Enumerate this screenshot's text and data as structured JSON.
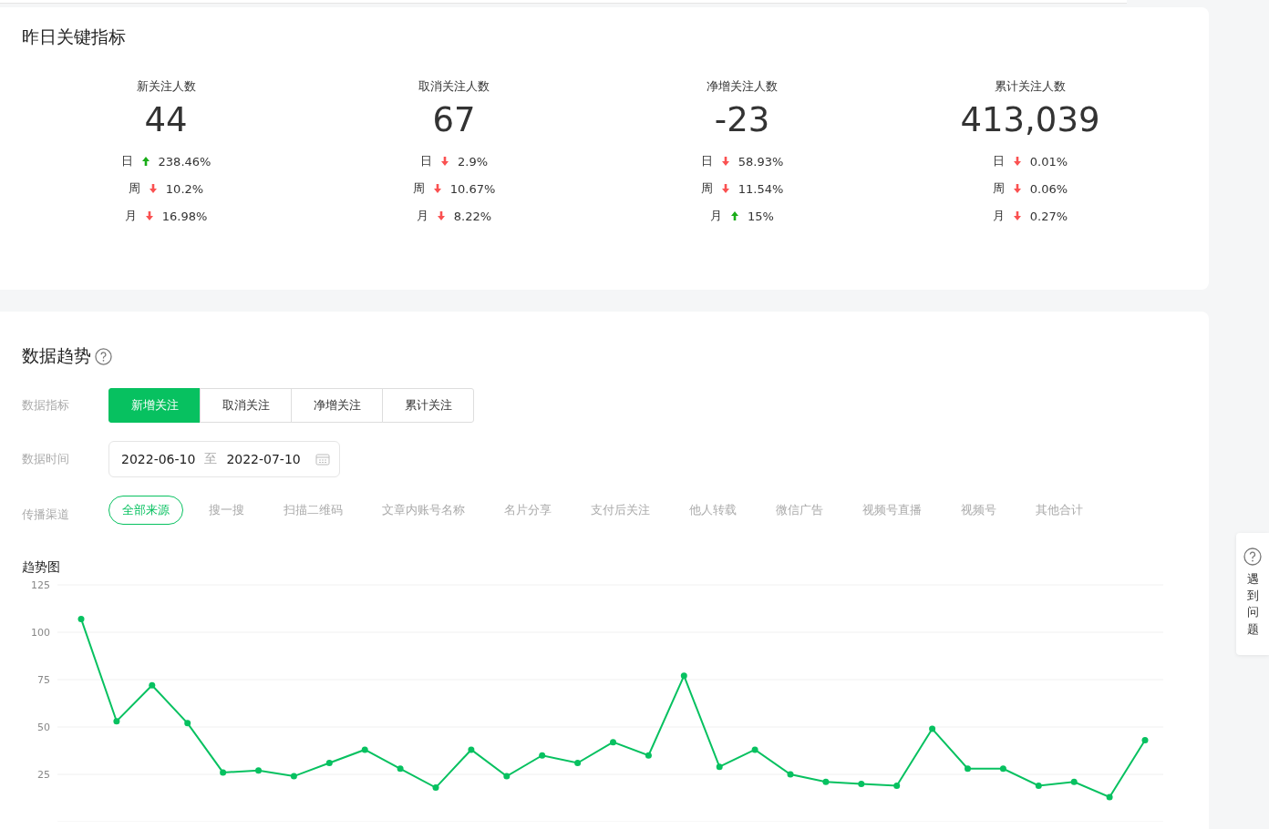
{
  "key_metrics": {
    "title": "昨日关键指标",
    "metrics": [
      {
        "label": "新关注人数",
        "value": "44",
        "changes": [
          {
            "period": "日",
            "up": true,
            "percent": "238.46%"
          },
          {
            "period": "周",
            "up": false,
            "percent": "10.2%"
          },
          {
            "period": "月",
            "up": false,
            "percent": "16.98%"
          }
        ]
      },
      {
        "label": "取消关注人数",
        "value": "67",
        "changes": [
          {
            "period": "日",
            "up": false,
            "percent": "2.9%"
          },
          {
            "period": "周",
            "up": false,
            "percent": "10.67%"
          },
          {
            "period": "月",
            "up": false,
            "percent": "8.22%"
          }
        ]
      },
      {
        "label": "净增关注人数",
        "value": "-23",
        "changes": [
          {
            "period": "日",
            "up": false,
            "percent": "58.93%"
          },
          {
            "period": "周",
            "up": false,
            "percent": "11.54%"
          },
          {
            "period": "月",
            "up": true,
            "percent": "15%"
          }
        ]
      },
      {
        "label": "累计关注人数",
        "value": "413,039",
        "changes": [
          {
            "period": "日",
            "up": false,
            "percent": "0.01%"
          },
          {
            "period": "周",
            "up": false,
            "percent": "0.06%"
          },
          {
            "period": "月",
            "up": false,
            "percent": "0.27%"
          }
        ]
      }
    ]
  },
  "trend": {
    "title": "数据趋势",
    "metric_label": "数据指标",
    "metric_tabs": [
      {
        "label": "新增关注",
        "selected": true
      },
      {
        "label": "取消关注",
        "selected": false
      },
      {
        "label": "净增关注",
        "selected": false
      },
      {
        "label": "累计关注",
        "selected": false
      }
    ],
    "time_label": "数据时间",
    "date_range": {
      "start": "2022-06-10",
      "separator": "至",
      "end": "2022-07-10"
    },
    "channel_label": "传播渠道",
    "channels": [
      {
        "label": "全部来源",
        "selected": true
      },
      {
        "label": "搜一搜",
        "selected": false
      },
      {
        "label": "扫描二维码",
        "selected": false
      },
      {
        "label": "文章内账号名称",
        "selected": false
      },
      {
        "label": "名片分享",
        "selected": false
      },
      {
        "label": "支付后关注",
        "selected": false
      },
      {
        "label": "他人转载",
        "selected": false
      },
      {
        "label": "微信广告",
        "selected": false
      },
      {
        "label": "视频号直播",
        "selected": false
      },
      {
        "label": "视频号",
        "selected": false
      },
      {
        "label": "其他合计",
        "selected": false
      }
    ],
    "chart_title": "趋势图",
    "chart_data": {
      "type": "line",
      "grid": true,
      "ylim": [
        0,
        125
      ],
      "yticks": [
        25,
        50,
        75,
        100,
        125
      ],
      "series": [
        {
          "color": "#07c160",
          "marker": true,
          "values": [
            107,
            53,
            72,
            52,
            26,
            27,
            24,
            31,
            38,
            28,
            18,
            38,
            24,
            35,
            31,
            42,
            35,
            77,
            29,
            38,
            25,
            21,
            20,
            19,
            49,
            28,
            28,
            19,
            21,
            13,
            43
          ]
        }
      ]
    }
  },
  "help": {
    "label": "遇到问题"
  }
}
